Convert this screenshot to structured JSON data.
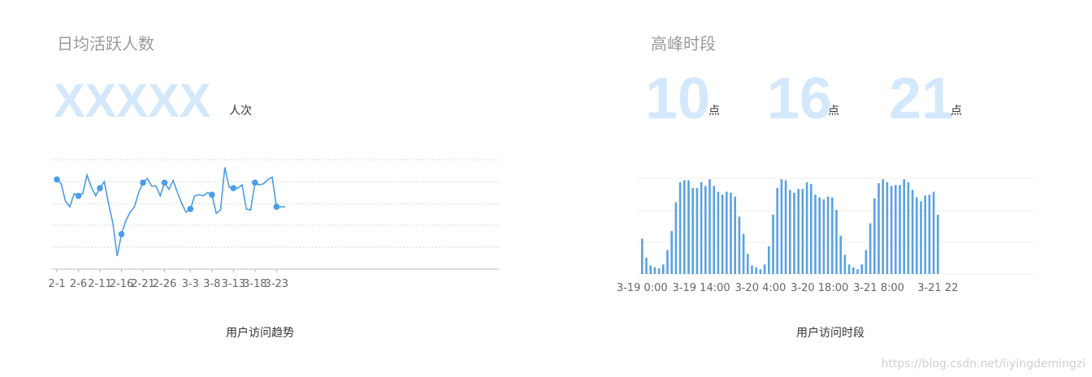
{
  "left_panel": {
    "title": "日均活跃人数",
    "value": "XXXXX",
    "unit": "人次",
    "caption": "用户访问趋势"
  },
  "right_panel": {
    "title": "高峰时段",
    "peaks": [
      {
        "value": "10",
        "unit": "点"
      },
      {
        "value": "16",
        "unit": "点"
      },
      {
        "value": "21",
        "unit": "点"
      }
    ],
    "caption": "用户访问时段"
  },
  "watermark": "https://blog.csdn.net/liyingdemingzi",
  "colors": {
    "line": "#4a9de8",
    "bar": "#5aa2e2",
    "big_number": "#d4e8fb",
    "grid": "#d9d9d9"
  },
  "chart_data": [
    {
      "type": "line",
      "title": "",
      "xlabel": "",
      "ylabel": "",
      "grid": true,
      "xtick_labels": [
        "2-1",
        "2-6",
        "2-11",
        "2-16",
        "2-21",
        "2-26",
        "3-3",
        "3-8",
        "3-13",
        "3-18",
        "3-23"
      ],
      "x": [
        "2-1",
        "2-2",
        "2-3",
        "2-4",
        "2-5",
        "2-6",
        "2-7",
        "2-8",
        "2-9",
        "2-10",
        "2-11",
        "2-12",
        "2-13",
        "2-14",
        "2-15",
        "2-16",
        "2-17",
        "2-18",
        "2-19",
        "2-20",
        "2-21",
        "2-22",
        "2-23",
        "2-24",
        "2-25",
        "2-26",
        "2-27",
        "2-28",
        "2-29",
        "3-1",
        "3-2",
        "3-3",
        "3-4",
        "3-5",
        "3-6",
        "3-7",
        "3-8",
        "3-9",
        "3-10",
        "3-11",
        "3-12",
        "3-13",
        "3-14",
        "3-15",
        "3-16",
        "3-17",
        "3-18",
        "3-19",
        "3-20",
        "3-21",
        "3-22",
        "3-23",
        "3-24",
        "3-25"
      ],
      "series": [
        {
          "values": [
            82,
            78,
            62,
            57,
            69,
            67,
            69,
            86,
            75,
            67,
            74,
            80,
            60,
            42,
            12,
            32,
            44,
            52,
            57,
            70,
            79,
            83,
            76,
            76,
            67,
            79,
            73,
            81,
            70,
            60,
            52,
            55,
            67,
            68,
            67,
            70,
            68,
            51,
            54,
            93,
            75,
            74,
            74,
            77,
            55,
            54,
            79,
            77,
            78,
            82,
            84,
            57,
            57,
            57
          ]
        }
      ],
      "ylim": [
        0,
        100
      ],
      "markers_at": [
        "2-1",
        "2-6",
        "2-11",
        "2-16",
        "2-21",
        "2-26",
        "3-3",
        "3-8",
        "3-13",
        "3-18",
        "3-23"
      ]
    },
    {
      "type": "bar",
      "title": "",
      "xlabel": "",
      "ylabel": "",
      "grid": true,
      "xtick_labels": [
        "3-19 0:00",
        "3-19 14:00",
        "3-20 4:00",
        "3-20 18:00",
        "3-21 8:00",
        "3-21 22"
      ],
      "series": [
        {
          "values": [
            37,
            17,
            9,
            7,
            6,
            10,
            25,
            45,
            75,
            96,
            98,
            98,
            90,
            90,
            96,
            92,
            99,
            92,
            86,
            83,
            86,
            85,
            81,
            60,
            42,
            21,
            9,
            7,
            5,
            10,
            29,
            62,
            90,
            99,
            98,
            88,
            85,
            89,
            89,
            96,
            94,
            83,
            80,
            78,
            81,
            80,
            67,
            40,
            20,
            10,
            7,
            5,
            10,
            25,
            53,
            79,
            95,
            99,
            96,
            92,
            93,
            93,
            99,
            96,
            88,
            80,
            76,
            82,
            83,
            86,
            62
          ]
        }
      ],
      "ylim": [
        0,
        100
      ]
    }
  ]
}
